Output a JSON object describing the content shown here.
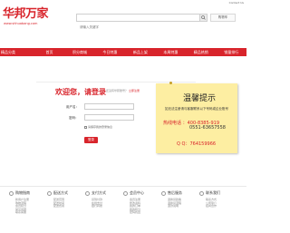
{
  "header": {
    "toplink": "Contact Us",
    "logo_name": "华邦万家",
    "logo_url": "www.shhuabang.com",
    "search_placeholder": "请输入关键字",
    "cart_label": "购物车"
  },
  "nav": {
    "items": [
      "精品分类",
      "首页",
      "积分商城",
      "今日特惠",
      "新品上架",
      "本周特惠",
      "精品热销",
      "销量排行"
    ]
  },
  "login": {
    "welcome": "欢迎您，请登录",
    "register_tip": "还没有华邦账号？",
    "register_link": "立即注册",
    "username_label": "用户名：",
    "password_label": "密码：",
    "remember_label": "请保存我的登录信息",
    "login_button": "登录"
  },
  "notice": {
    "title": "温馨提示",
    "text": "如无法注册请与客服联系以下号码或企业账号",
    "hotline": "热线电话 ：400-8385-919",
    "phone2": "0551-63657558",
    "qq": "Q Q：764159966"
  },
  "footer": {
    "columns": [
      {
        "title": "购物指南",
        "links": [
          "新用户注册",
          "购物流程",
          "会员积分",
          "常见问题",
          "联系客服"
        ]
      },
      {
        "title": "配送方式",
        "links": [
          "配送范围",
          "配送时间",
          "配送费用"
        ]
      },
      {
        "title": "支付方式",
        "links": [
          "货到付款",
          "在线支付",
          "银行转账"
        ]
      },
      {
        "title": "会员中心",
        "links": [
          "会员注册",
          "修改资料",
          "我的订单",
          "我的积分",
          "密码找回"
        ]
      },
      {
        "title": "售后服务",
        "links": [
          "退换货政策",
          "退换货流程",
          "退款说明"
        ]
      },
      {
        "title": "联系我们",
        "links": [
          "联系方式",
          "公司简介",
          "招商合作"
        ]
      }
    ]
  }
}
